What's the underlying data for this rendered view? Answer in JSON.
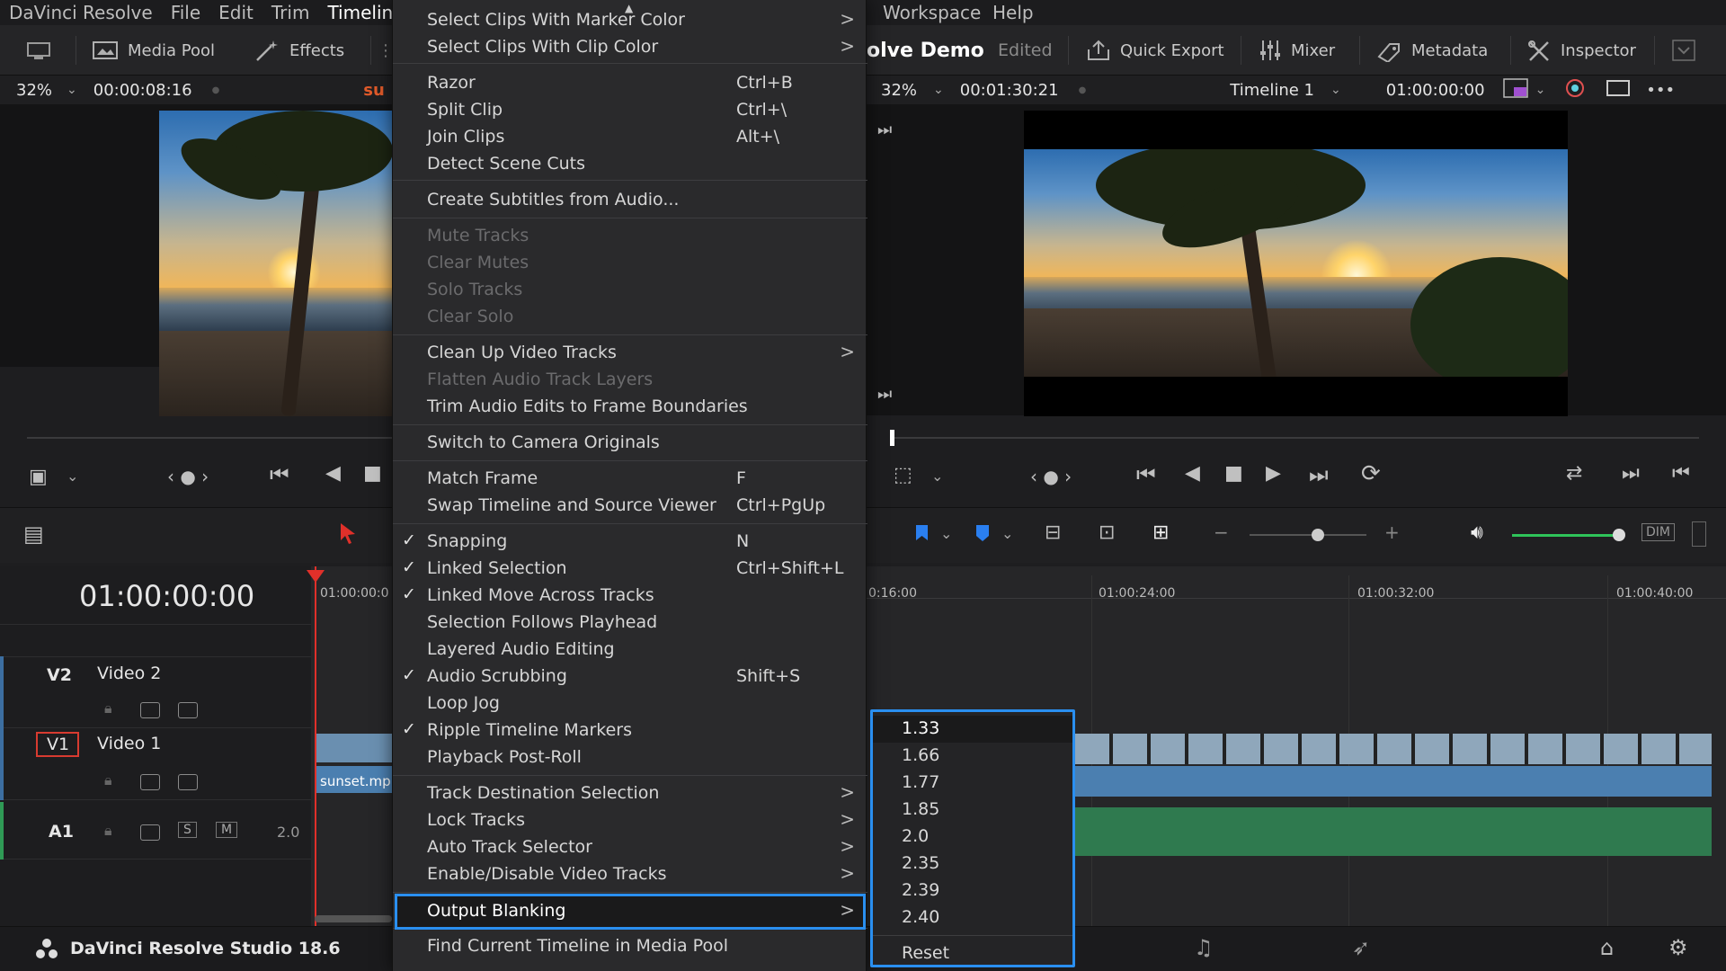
{
  "menubar": {
    "items": [
      {
        "label": "DaVinci Resolve"
      },
      {
        "label": "File"
      },
      {
        "label": "Edit"
      },
      {
        "label": "Trim"
      },
      {
        "label": "Timeline"
      },
      {
        "label": "Workspace"
      },
      {
        "label": "Help"
      }
    ]
  },
  "toolbar": {
    "media_pool": "Media Pool",
    "effects": "Effects",
    "project_title": "olve Demo",
    "edited": "Edited",
    "quick_export": "Quick Export",
    "mixer": "Mixer",
    "metadata": "Metadata",
    "inspector": "Inspector"
  },
  "source_viewer": {
    "zoom": "32%",
    "timecode": "00:00:08:16",
    "clip_name_partial": "su"
  },
  "timeline_viewer": {
    "zoom": "32%",
    "timecode": "00:01:30:21",
    "timeline_name": "Timeline 1",
    "record_timecode": "01:00:00:00"
  },
  "timeline": {
    "current_timecode": "01:00:00:00",
    "ruler": [
      "01:00:00:0",
      "0:16:00",
      "01:00:24:00",
      "01:00:32:00",
      "01:00:40:00"
    ],
    "tracks": [
      {
        "id": "V2",
        "name": "Video 2"
      },
      {
        "id": "V1",
        "name": "Video 1"
      },
      {
        "id": "A1",
        "name": "",
        "level": "2.0",
        "solo": "S",
        "mute": "M"
      }
    ],
    "clip_name": "sunset.mp"
  },
  "volume": {
    "dim_label": "DIM"
  },
  "timeline_menu": {
    "items": [
      {
        "label": "Select Clips With Marker Color",
        "arrow": true
      },
      {
        "label": "Select Clips With Clip Color",
        "arrow": true
      },
      {
        "label": "Razor",
        "shortcut": "Ctrl+B"
      },
      {
        "label": "Split Clip",
        "shortcut": "Ctrl+\\"
      },
      {
        "label": "Join Clips",
        "shortcut": "Alt+\\"
      },
      {
        "label": "Detect Scene Cuts"
      },
      {
        "label": "Create Subtitles from Audio..."
      },
      {
        "label": "Mute Tracks",
        "disabled": true
      },
      {
        "label": "Clear Mutes",
        "disabled": true
      },
      {
        "label": "Solo Tracks",
        "disabled": true
      },
      {
        "label": "Clear Solo",
        "disabled": true
      },
      {
        "label": "Clean Up Video Tracks",
        "arrow": true
      },
      {
        "label": "Flatten Audio Track Layers",
        "disabled": true
      },
      {
        "label": "Trim Audio Edits to Frame Boundaries"
      },
      {
        "label": "Switch to Camera Originals"
      },
      {
        "label": "Match Frame",
        "shortcut": "F"
      },
      {
        "label": "Swap Timeline and Source Viewer",
        "shortcut": "Ctrl+PgUp"
      },
      {
        "label": "Snapping",
        "shortcut": "N",
        "checked": true
      },
      {
        "label": "Linked Selection",
        "shortcut": "Ctrl+Shift+L",
        "checked": true
      },
      {
        "label": "Linked Move Across Tracks",
        "checked": true
      },
      {
        "label": "Selection Follows Playhead"
      },
      {
        "label": "Layered Audio Editing"
      },
      {
        "label": "Audio Scrubbing",
        "shortcut": "Shift+S",
        "checked": true
      },
      {
        "label": "Loop Jog"
      },
      {
        "label": "Ripple Timeline Markers",
        "checked": true
      },
      {
        "label": "Playback Post-Roll"
      },
      {
        "label": "Track Destination Selection",
        "arrow": true
      },
      {
        "label": "Lock Tracks",
        "arrow": true
      },
      {
        "label": "Auto Track Selector",
        "arrow": true
      },
      {
        "label": "Enable/Disable Video Tracks",
        "arrow": true
      },
      {
        "label": "Output Blanking",
        "arrow": true,
        "highlighted": true
      },
      {
        "label": "Find Current Timeline in Media Pool"
      }
    ],
    "check_glyph": "✓",
    "arrow_glyph": ">"
  },
  "output_blanking_submenu": {
    "items": [
      "1.33",
      "1.66",
      "1.77",
      "1.85",
      "2.0",
      "2.35",
      "2.39",
      "2.40"
    ],
    "reset": "Reset",
    "selected": "1.33"
  },
  "bottombar": {
    "app_name": "DaVinci Resolve Studio 18.6"
  },
  "colors": {
    "accent_blue": "#2a8ff0",
    "playhead_red": "#e0302a",
    "video_clip": "#4b7fb0",
    "audio_clip": "#2f7a4f",
    "volume_green": "#2fc45a"
  }
}
